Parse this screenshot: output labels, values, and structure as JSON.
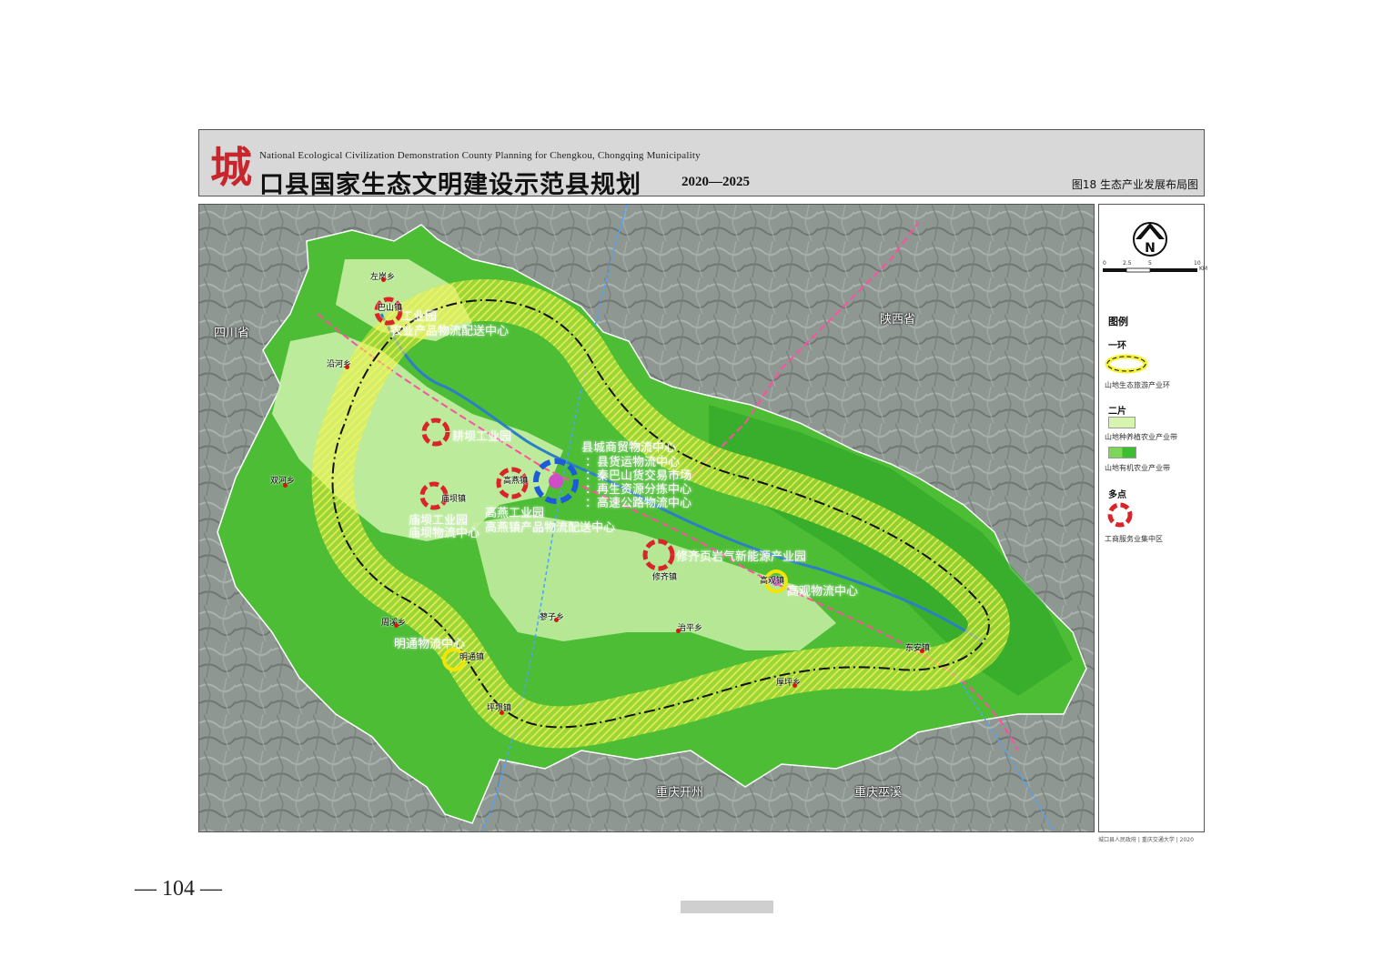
{
  "header": {
    "logo_char": "城",
    "english_title": "National Ecological Civilization Demonstration County Planning for Chengkou, Chongqing Municipality",
    "chinese_title": "口县国家生态文明建设示范县规划",
    "years": "2020—2025",
    "figure_title": "图18  生态产业发展布局图"
  },
  "map": {
    "regions": {
      "sichuan": "四川省",
      "shaanxi": "陕西省",
      "chongqing_kaizhou": "重庆开州",
      "chongqing_wuxi": "重庆巫溪"
    },
    "centers": {
      "north_park_1": "工业园",
      "north_park_2": "农业产品物流配送中心",
      "gengba": "耕坝工业园",
      "county_title": "县城商贸物流中心",
      "county_1": "：县货运物流中心",
      "county_2": "：秦巴山货交易市场",
      "county_3": "：再生资源分拣中心",
      "county_4": "：高速公路物流中心",
      "miaoba_1": "庙坝工业园",
      "miaoba_2": "庙坝物流中心",
      "gaoyan_1": "高燕工业园",
      "gaoyan_2": "高燕镇产品物流配送中心",
      "xiuqi": "修齐页岩气新能源产业园",
      "gaoguan": "高观物流中心",
      "mingtong": "明通物流中心"
    },
    "towns": [
      "左岚乡",
      "沿河乡",
      "双河乡",
      "庙坝镇",
      "周溪乡",
      "明通镇",
      "坪坝镇",
      "蓼子乡",
      "治平乡",
      "高观镇",
      "东安镇",
      "厚坪乡",
      "修齐镇",
      "高燕镇",
      "巴山镇"
    ]
  },
  "legend": {
    "title": "图例",
    "scale_ticks": [
      "0",
      "2.5",
      "5",
      "10"
    ],
    "scale_unit": "KM",
    "ring_head": "一环",
    "ring_label": "山地生态旅游产业环",
    "zone_head": "二片",
    "zone1_label": "山地种养植农业产业带",
    "zone2_label": "山地有机农业产业带",
    "point_head": "多点",
    "point_label": "工商服务业集中区",
    "colors": {
      "ring_yellow": "#f5f23a",
      "zone_light": "#d8f5b0",
      "zone_green": "#3cbf2f",
      "point_red": "#d9252a"
    }
  },
  "footer": {
    "credit": "城口县人民政府 | 重庆交通大学 | 2020",
    "page_number": "— 104 —"
  }
}
